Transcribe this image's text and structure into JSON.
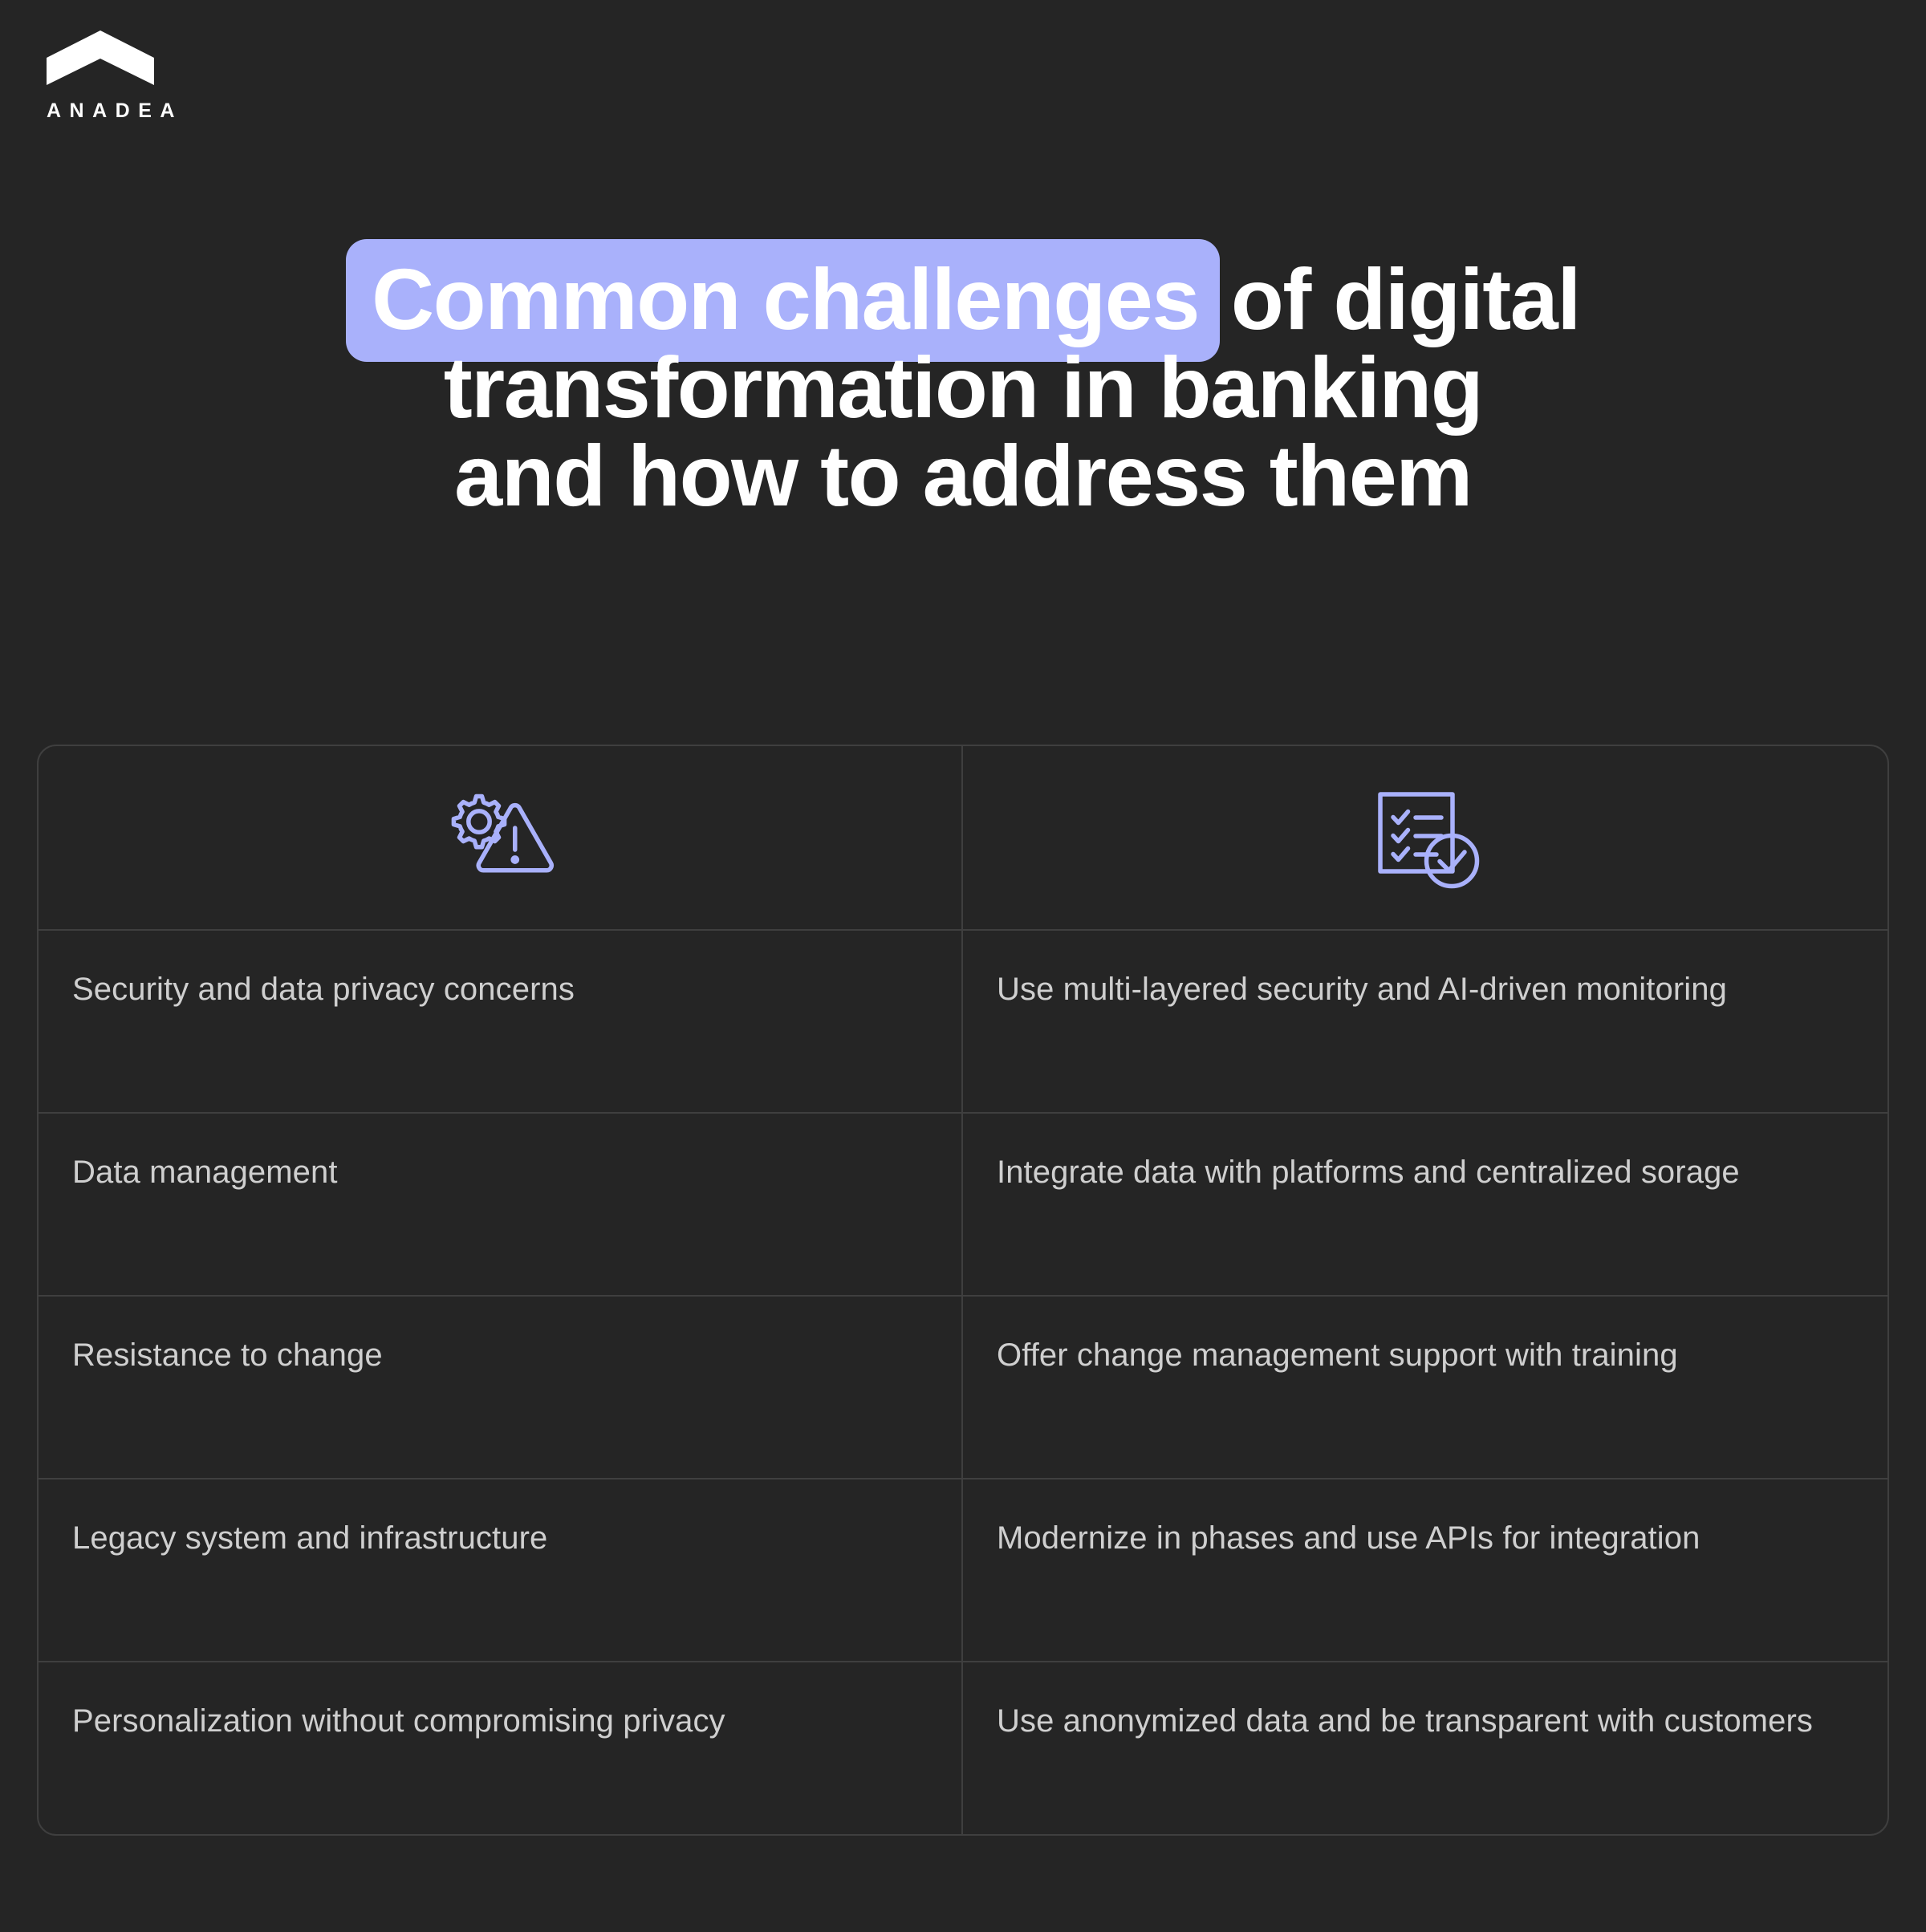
{
  "brand": {
    "name": "ANADEA",
    "logo_icon": "chevron-up-logo"
  },
  "headline": {
    "highlight": "Common challenges",
    "rest_line1": "of digital",
    "line2": "transformation in banking",
    "line3": "and how to address them",
    "highlight_color": "#a9b1fb",
    "text_color": "#ffffff"
  },
  "table": {
    "accent_color": "#a9b1fb",
    "border_color": "#3f3f3f",
    "header": {
      "left_icon": "gear-warning-triangle-icon",
      "right_icon": "checklist-check-circle-icon"
    },
    "rows": [
      {
        "challenge": "Security and data privacy concerns",
        "solution": "Use multi-layered security and AI-driven monitoring"
      },
      {
        "challenge": "Data management",
        "solution": "Integrate data with platforms and centralized sorage"
      },
      {
        "challenge": "Resistance to change",
        "solution": "Offer change management support with training"
      },
      {
        "challenge": "Legacy system and infrastructure",
        "solution": "Modernize in phases and use APIs for integration"
      },
      {
        "challenge": "Personalization without compromising privacy",
        "solution": "Use anonymized data and be transparent with customers"
      }
    ]
  }
}
